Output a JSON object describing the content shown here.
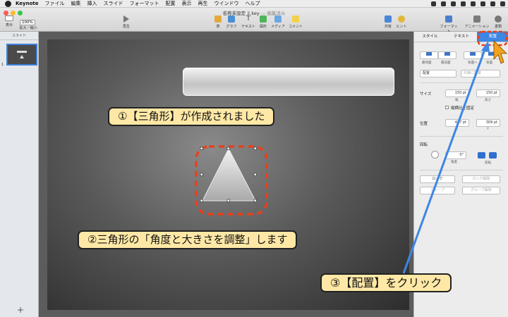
{
  "menubar": {
    "app": "Keynote",
    "items": [
      "ファイル",
      "編集",
      "挿入",
      "スライド",
      "フォーマット",
      "配置",
      "表示",
      "再生",
      "ウインドウ",
      "ヘルプ"
    ]
  },
  "window": {
    "title": "名称未設定 2.key",
    "status": "— 編集済み"
  },
  "toolbar": {
    "view_label": "表示",
    "zoom_value": "100%",
    "zoom_label": "拡大／縮小",
    "play_label": "再生",
    "table_label": "表",
    "chart_label": "グラフ",
    "text_label": "テキスト",
    "shape_label": "図形",
    "media_label": "メディア",
    "comment_label": "コメント",
    "share_label": "共有",
    "tips_label": "ヒント",
    "format_label": "フォーマット",
    "animation_label": "アニメーション",
    "setup_label": "書類"
  },
  "sidebar": {
    "header": "スライド",
    "slide_number": "1",
    "add_label": "+"
  },
  "inspector": {
    "tabs": [
      "スタイル",
      "テキスト",
      "配置"
    ],
    "back_label": "最背面",
    "backward_label": "背面へ",
    "front_label": "最前面",
    "forward_label": "背面",
    "align_select": "配置",
    "distribute_select": "均等に配置",
    "size_label": "サイズ",
    "width_value": "150 pt",
    "height_value": "150 pt",
    "width_sub": "幅",
    "height_sub": "高さ",
    "constrain_label": "縦横比を固定",
    "position_label": "位置",
    "x_value": "477 pt",
    "y_value": "309 pt",
    "x_sub": "X",
    "y_sub": "Y",
    "rotate_label": "回転",
    "angle_value": "0°",
    "angle_sub": "角度",
    "flip_sub": "反転",
    "lock_label": "ロック",
    "unlock_label": "ロック解除",
    "group_label": "グループ",
    "ungroup_label": "グループ解除"
  },
  "annotations": {
    "note1": "①【三角形】が作成されました",
    "note2": "②三角形の「角度と大きさを調整」します",
    "note3": "③【配置】をクリック"
  },
  "colors": {
    "note_fill": "#ffe8a6",
    "highlight_red": "#e8401c",
    "arrow_blue": "#3d86e4",
    "cursor_orange": "#f2a21c"
  }
}
